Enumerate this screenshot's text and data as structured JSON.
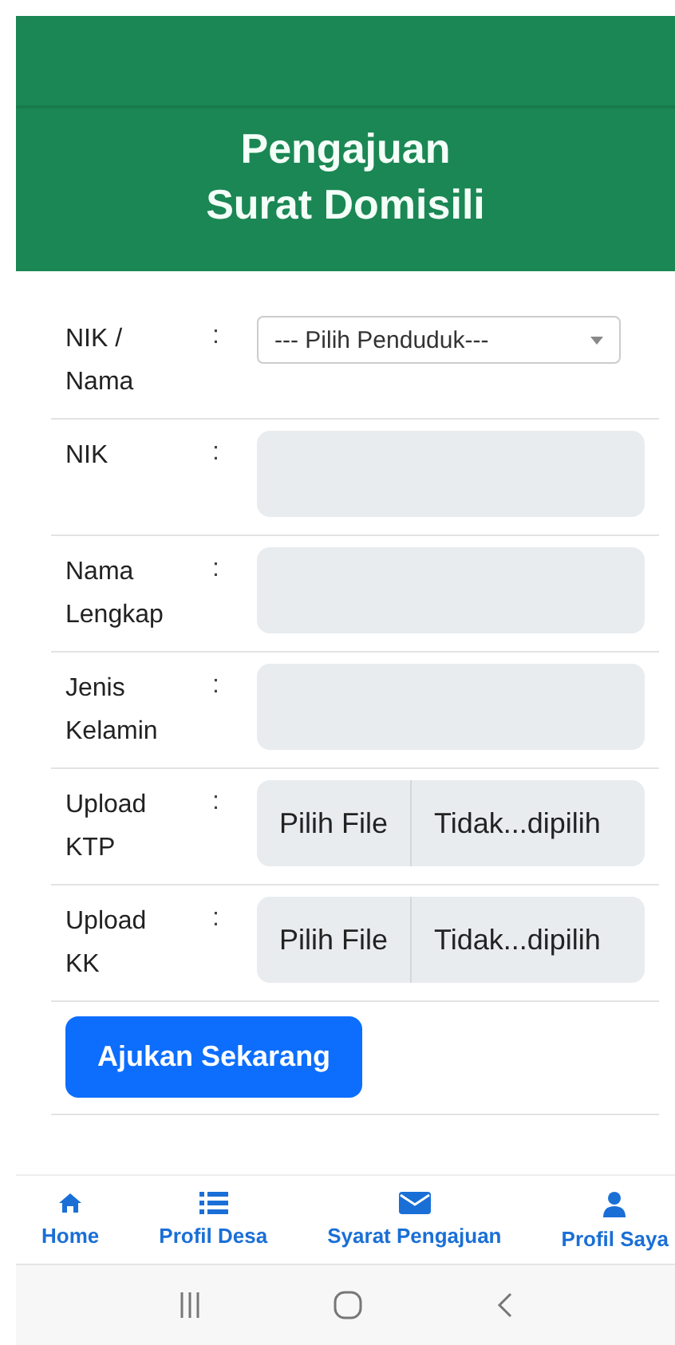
{
  "header": {
    "title_lines": [
      "Pengajuan",
      "Surat Domisili"
    ]
  },
  "form": {
    "fields": [
      {
        "kind": "select",
        "label": "NIK / Nama",
        "separator": ":",
        "value": "--- Pilih Penduduk---"
      },
      {
        "kind": "text",
        "label": "NIK",
        "separator": ":"
      },
      {
        "kind": "text",
        "label": "Nama Lengkap",
        "separator": ":"
      },
      {
        "kind": "text",
        "label": "Jenis Kelamin",
        "separator": ":"
      },
      {
        "kind": "file",
        "label": "Upload KTP",
        "separator": ":",
        "button": "Pilih File",
        "status": "Tidak...dipilih"
      },
      {
        "kind": "file",
        "label": "Upload KK",
        "separator": ":",
        "button": "Pilih File",
        "status": "Tidak...dipilih"
      }
    ],
    "submit": "Ajukan Sekarang"
  },
  "bottom_nav": [
    {
      "label": "Home"
    },
    {
      "label": "Profil Desa"
    },
    {
      "label": "Syarat Pengajuan"
    },
    {
      "label": "Profil Saya"
    }
  ]
}
